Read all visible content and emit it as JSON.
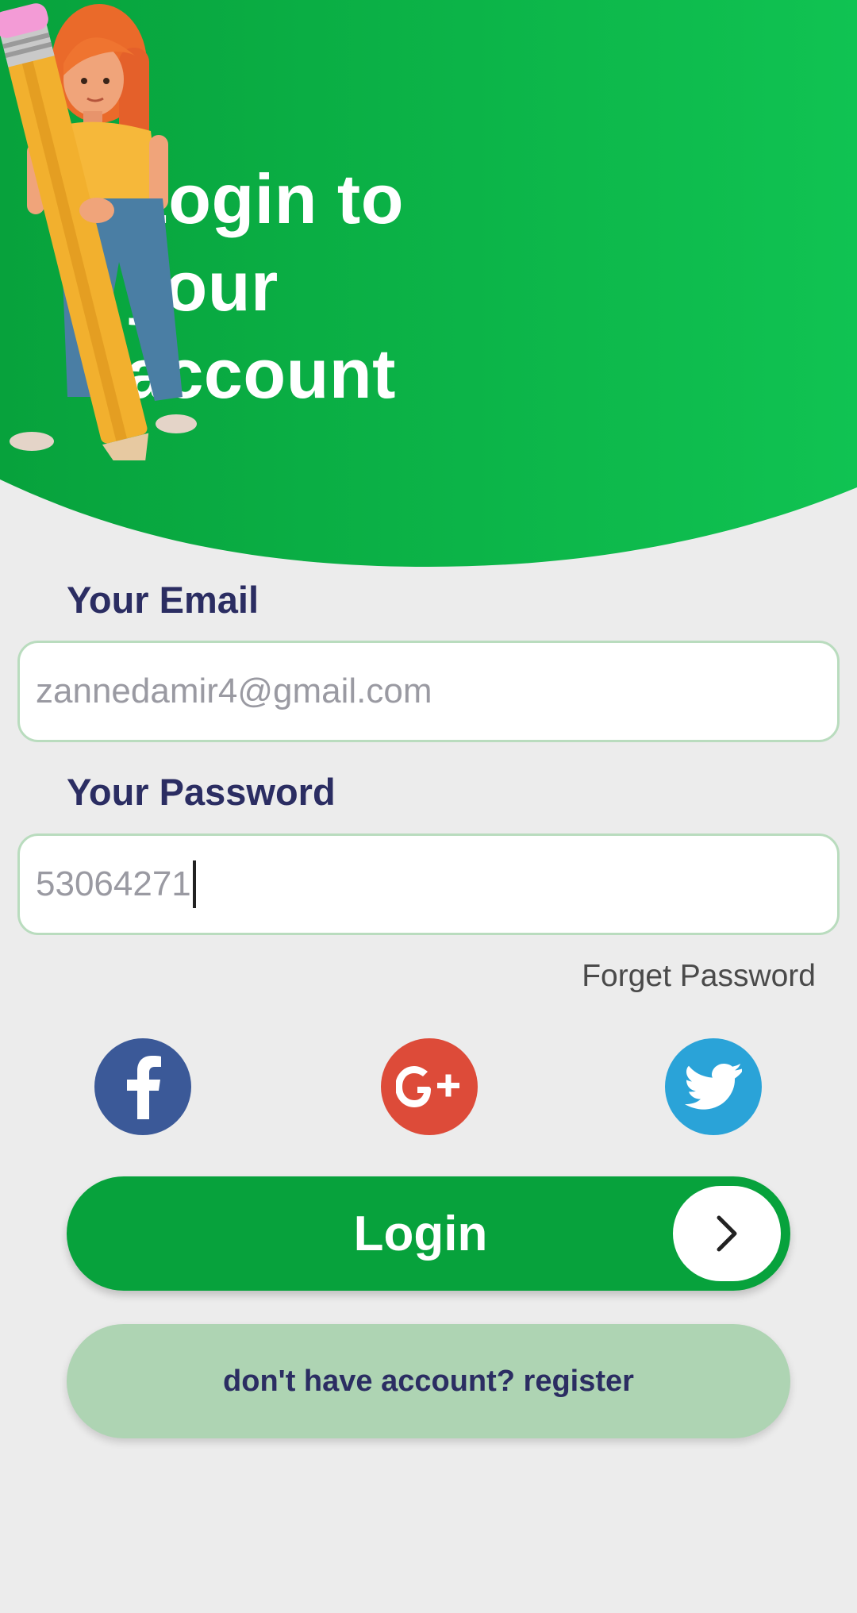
{
  "header": {
    "title": "Login to your account",
    "illustration": "girl-holding-pencil-illustration"
  },
  "form": {
    "email_label": "Your Email",
    "email_value": "zannedamir4@gmail.com",
    "password_label": "Your Password",
    "password_value": "53064271",
    "forget_password": "Forget Password"
  },
  "social": {
    "facebook_icon": "facebook-icon",
    "google_plus_icon": "google-plus-icon",
    "twitter_icon": "twitter-icon",
    "google_plus_text": "G+"
  },
  "actions": {
    "login_label": "Login",
    "register_label": "don't have account? register"
  },
  "colors": {
    "primary_green": "#07a23c",
    "header_green": "#0db94d",
    "label_navy": "#2b2d62",
    "field_border": "#b9dcbe",
    "register_bg": "#aed4b3",
    "facebook": "#3b5998",
    "google_plus": "#dd4b39",
    "twitter": "#2aa3d8"
  }
}
